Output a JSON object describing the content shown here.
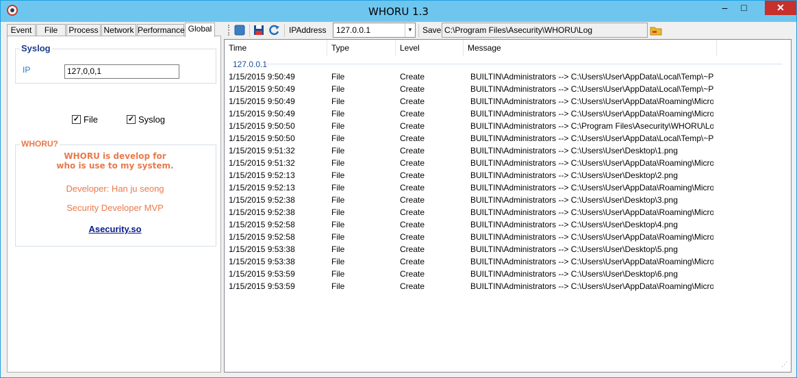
{
  "window": {
    "title": "WHORU 1.3",
    "min_label": "–",
    "max_label": "□",
    "close_label": "✕"
  },
  "tabs": [
    {
      "label": "Event"
    },
    {
      "label": "File"
    },
    {
      "label": "Process"
    },
    {
      "label": "Network"
    },
    {
      "label": "Performance"
    },
    {
      "label": "Global"
    }
  ],
  "syslog": {
    "title": "Syslog",
    "ip_label": "IP",
    "ip_value": "127,0,0,1"
  },
  "checks": {
    "file_label": "File",
    "file_checked": true,
    "syslog_label": "Syslog",
    "syslog_checked": true
  },
  "about": {
    "title": "WHORU?",
    "line1": "WHORU is develop for",
    "line2": "who is use to my system.",
    "developer": "Developer: Han ju seong",
    "mvp": "Security Developer MVP",
    "link": "Asecurity.so"
  },
  "toolbar": {
    "ipaddress_label": "IPAddress",
    "ipaddress_value": "127.0.0.1",
    "save_label": "Save",
    "save_path": "C:\\Program Files\\Asecurity\\WHORU\\Log"
  },
  "list": {
    "columns": [
      "Time",
      "Type",
      "Level",
      "Message"
    ],
    "group_label": "127.0.0.1",
    "rows": [
      [
        "1/15/2015 9:50:49",
        "File",
        "Create",
        "BUILTIN\\Administrators --> C:\\Users\\User\\AppData\\Local\\Temp\\~PI..."
      ],
      [
        "1/15/2015 9:50:49",
        "File",
        "Create",
        "BUILTIN\\Administrators --> C:\\Users\\User\\AppData\\Local\\Temp\\~PI..."
      ],
      [
        "1/15/2015 9:50:49",
        "File",
        "Create",
        "BUILTIN\\Administrators --> C:\\Users\\User\\AppData\\Roaming\\Microso..."
      ],
      [
        "1/15/2015 9:50:49",
        "File",
        "Create",
        "BUILTIN\\Administrators --> C:\\Users\\User\\AppData\\Roaming\\Microso..."
      ],
      [
        "1/15/2015 9:50:50",
        "File",
        "Create",
        "BUILTIN\\Administrators --> C:\\Program Files\\Asecurity\\WHORU\\Log\\W..."
      ],
      [
        "1/15/2015 9:50:50",
        "File",
        "Create",
        "BUILTIN\\Administrators --> C:\\Users\\User\\AppData\\Local\\Temp\\~PI..."
      ],
      [
        "1/15/2015 9:51:32",
        "File",
        "Create",
        "BUILTIN\\Administrators --> C:\\Users\\User\\Desktop\\1.png"
      ],
      [
        "1/15/2015 9:51:32",
        "File",
        "Create",
        "BUILTIN\\Administrators --> C:\\Users\\User\\AppData\\Roaming\\Microso..."
      ],
      [
        "1/15/2015 9:52:13",
        "File",
        "Create",
        "BUILTIN\\Administrators --> C:\\Users\\User\\Desktop\\2.png"
      ],
      [
        "1/15/2015 9:52:13",
        "File",
        "Create",
        "BUILTIN\\Administrators --> C:\\Users\\User\\AppData\\Roaming\\Microso..."
      ],
      [
        "1/15/2015 9:52:38",
        "File",
        "Create",
        "BUILTIN\\Administrators --> C:\\Users\\User\\Desktop\\3.png"
      ],
      [
        "1/15/2015 9:52:38",
        "File",
        "Create",
        "BUILTIN\\Administrators --> C:\\Users\\User\\AppData\\Roaming\\Microso..."
      ],
      [
        "1/15/2015 9:52:58",
        "File",
        "Create",
        "BUILTIN\\Administrators --> C:\\Users\\User\\Desktop\\4.png"
      ],
      [
        "1/15/2015 9:52:58",
        "File",
        "Create",
        "BUILTIN\\Administrators --> C:\\Users\\User\\AppData\\Roaming\\Microso..."
      ],
      [
        "1/15/2015 9:53:38",
        "File",
        "Create",
        "BUILTIN\\Administrators --> C:\\Users\\User\\Desktop\\5.png"
      ],
      [
        "1/15/2015 9:53:38",
        "File",
        "Create",
        "BUILTIN\\Administrators --> C:\\Users\\User\\AppData\\Roaming\\Microso..."
      ],
      [
        "1/15/2015 9:53:59",
        "File",
        "Create",
        "BUILTIN\\Administrators --> C:\\Users\\User\\Desktop\\6.png"
      ],
      [
        "1/15/2015 9:53:59",
        "File",
        "Create",
        "BUILTIN\\Administrators --> C:\\Users\\User\\AppData\\Roaming\\Microso..."
      ]
    ]
  },
  "colors": {
    "titlebar": "#6ec6ef",
    "close": "#c7302b",
    "about_text": "#e87a4c",
    "syslog_title": "#1a3d8a",
    "link": "#0a1a8a"
  },
  "icons": {
    "stop": "stop-icon",
    "save": "save-disk-icon",
    "refresh": "refresh-icon",
    "folder": "folder-icon",
    "app": "app-eye-icon"
  }
}
